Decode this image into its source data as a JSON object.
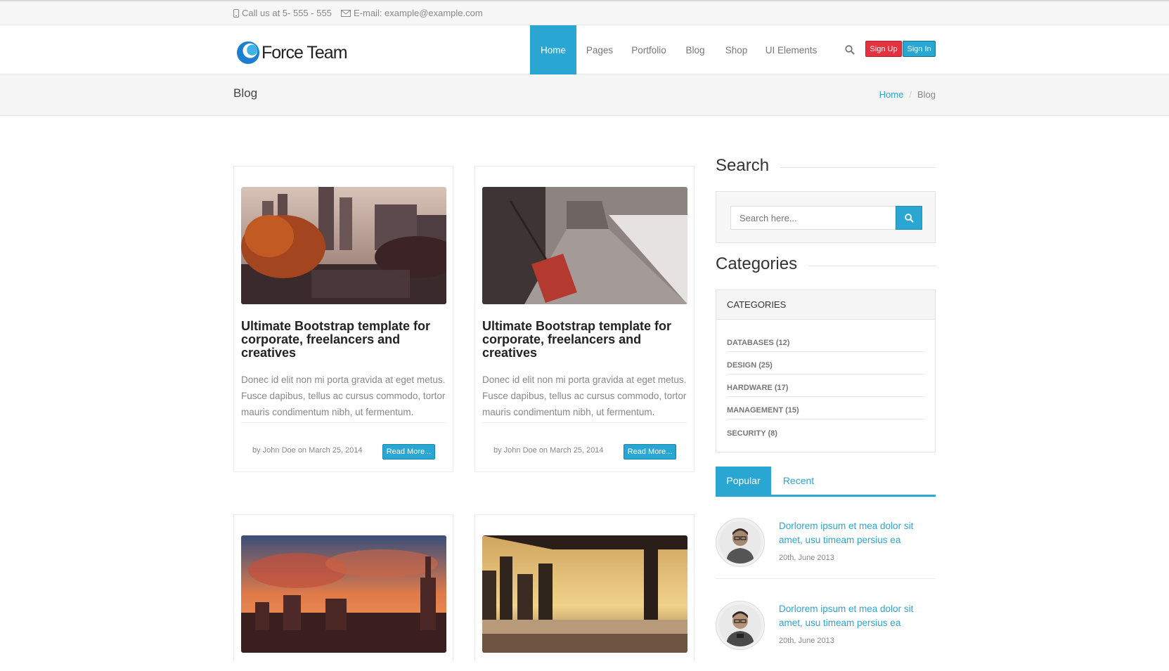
{
  "topbar": {
    "phone": "Call us at 5- 555 - 555",
    "email": "E-mail: example@example.com"
  },
  "brand": {
    "name": "Force Team"
  },
  "nav": {
    "items": [
      "Home",
      "Pages",
      "Portfolio",
      "Blog",
      "Shop",
      "UI Elements"
    ],
    "active": "Home",
    "signup": "Sign Up",
    "signin": "Sign In"
  },
  "page": {
    "title": "Blog",
    "breadcrumb": [
      "Home",
      "Blog"
    ]
  },
  "posts": [
    {
      "title": "Ultimate Bootstrap template for corporate, freelancers and creatives",
      "excerpt": "Donec id elit non mi porta gravida at eget metus. Fusce dapibus, tellus ac cursus commodo, tortor mauris condimentum nibh, ut fermentum.",
      "meta": "by John Doe on March 25, 2014",
      "more": "Read More..."
    },
    {
      "title": "Ultimate Bootstrap template for corporate, freelancers and creatives",
      "excerpt": "Donec id elit non mi porta gravida at eget metus. Fusce dapibus, tellus ac cursus commodo, tortor mauris condimentum nibh, ut fermentum.",
      "meta": "by John Doe on March 25, 2014",
      "more": "Read More..."
    }
  ],
  "sidebar": {
    "search_heading": "Search",
    "search_placeholder": "Search here...",
    "categories_heading": "Categories",
    "categories_title": "CATEGORIES",
    "categories": [
      "DATABASES (12)",
      "DESIGN (25)",
      "HARDWARE (17)",
      "MANAGEMENT (15)",
      "SECURITY (8)"
    ],
    "tabs": [
      "Popular",
      "Recent"
    ],
    "popular": [
      {
        "title": "Dorlorem ipsum et mea dolor sit amet, usu timeam persius ea",
        "date": "20th, June 2013"
      },
      {
        "title": "Dorlorem ipsum et mea dolor sit amet, usu timeam persius ea",
        "date": "20th, June 2013"
      }
    ]
  },
  "colors": {
    "accent": "#2aa6d3",
    "signup": "#e5323f"
  }
}
